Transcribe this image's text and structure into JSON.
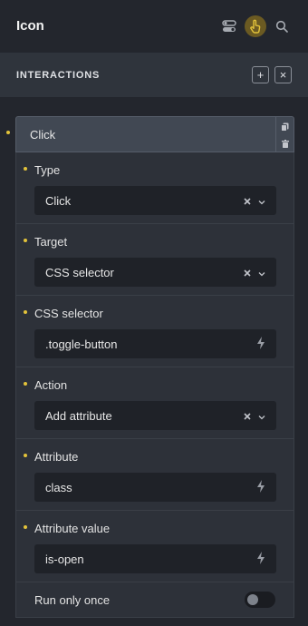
{
  "header": {
    "title": "Icon"
  },
  "section": {
    "title": "INTERACTIONS",
    "add": "+",
    "remove": "×"
  },
  "item": {
    "label": "Click"
  },
  "fields": [
    {
      "label": "Type",
      "value": "Click",
      "kind": "select"
    },
    {
      "label": "Target",
      "value": "CSS selector",
      "kind": "select"
    },
    {
      "label": "CSS selector",
      "value": ".toggle-button",
      "kind": "dynamic"
    },
    {
      "label": "Action",
      "value": "Add attribute",
      "kind": "select"
    },
    {
      "label": "Attribute",
      "value": "class",
      "kind": "dynamic"
    },
    {
      "label": "Attribute value",
      "value": "is-open",
      "kind": "dynamic"
    }
  ],
  "run_once": {
    "label": "Run only once",
    "enabled": false
  },
  "colors": {
    "accent": "#e3c33a",
    "active_icon_bg": "#6b5a22"
  }
}
